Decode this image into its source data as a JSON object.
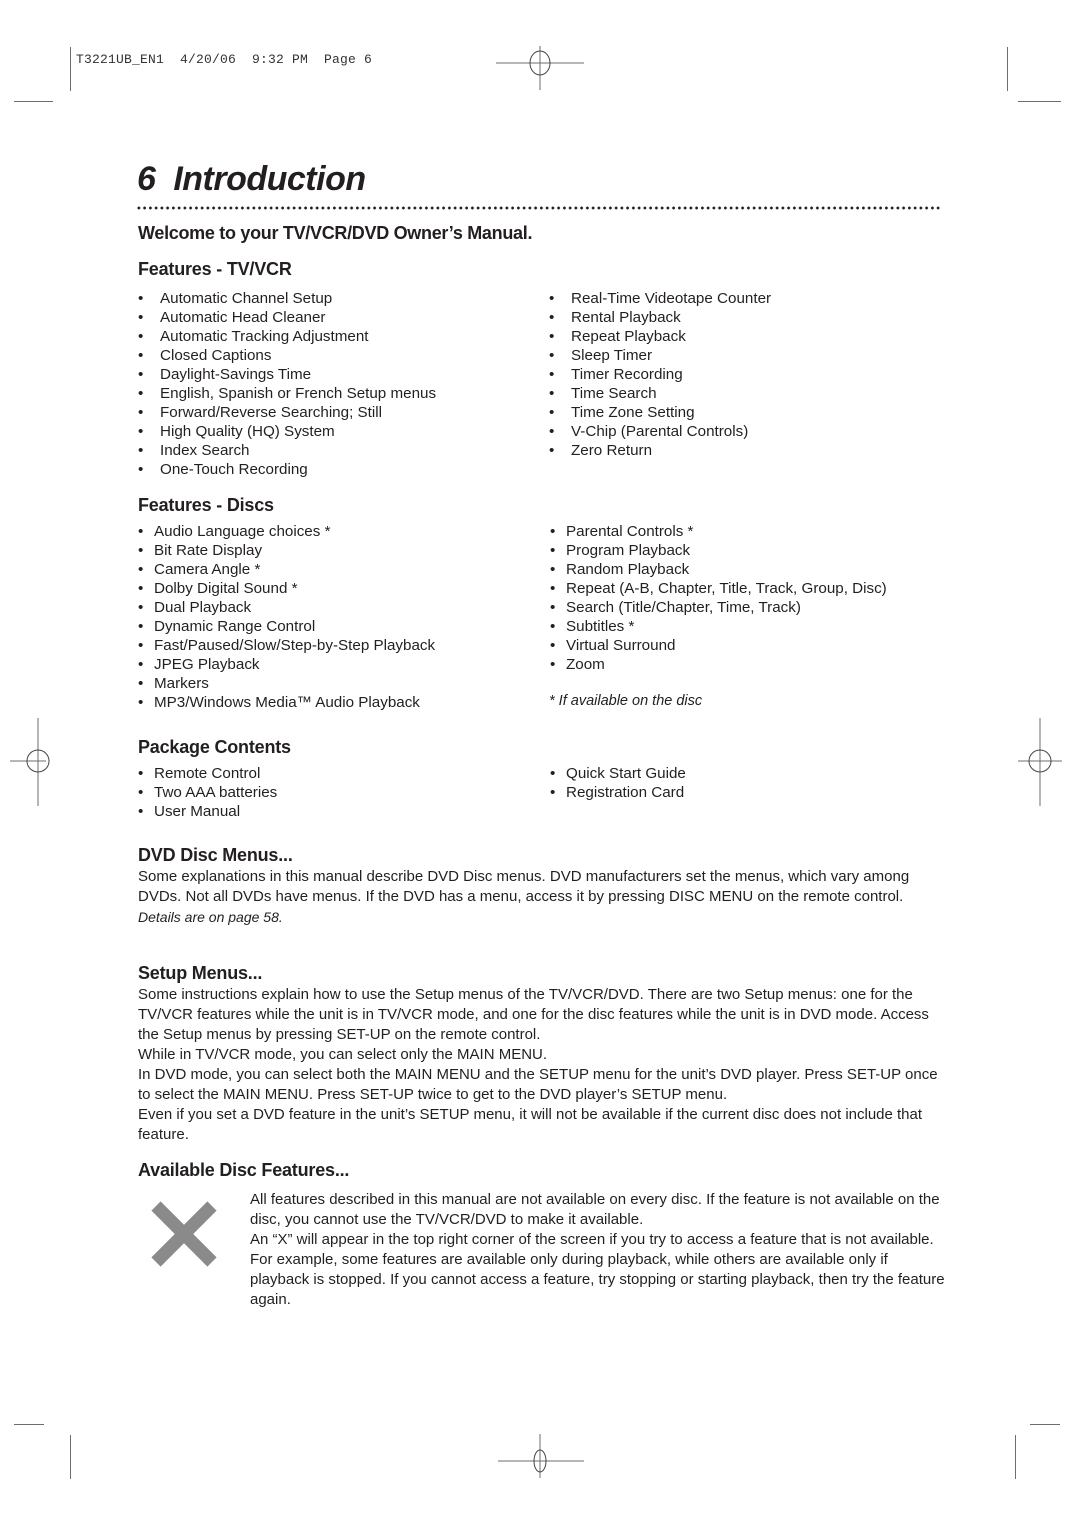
{
  "print_slug": "T3221UB_EN1  4/20/06  9:32 PM  Page 6",
  "page": {
    "number": "6",
    "title": "Introduction"
  },
  "welcome": "Welcome to your TV/VCR/DVD Owner’s Manual.",
  "features_tvvcr": {
    "heading": "Features - TV/VCR",
    "left": [
      "Automatic Channel Setup",
      "Automatic Head Cleaner",
      "Automatic Tracking Adjustment",
      "Closed Captions",
      "Daylight-Savings Time",
      "English, Spanish or French Setup menus",
      "Forward/Reverse Searching; Still",
      "High Quality (HQ) System",
      "Index Search",
      "One-Touch Recording"
    ],
    "right": [
      "Real-Time Videotape Counter",
      "Rental Playback",
      "Repeat Playback",
      "Sleep Timer",
      "Timer Recording",
      "Time Search",
      "Time Zone Setting",
      "V-Chip (Parental Controls)",
      "Zero Return"
    ]
  },
  "features_discs": {
    "heading": "Features - Discs",
    "left": [
      "Audio Language choices *",
      "Bit Rate Display",
      "Camera Angle *",
      "Dolby Digital Sound *",
      "Dual Playback",
      "Dynamic Range Control",
      "Fast/Paused/Slow/Step-by-Step Playback",
      "JPEG Playback",
      "Markers",
      "MP3/Windows Media™ Audio Playback"
    ],
    "right": [
      "Parental Controls *",
      "Program Playback",
      "Random Playback",
      "Repeat (A-B, Chapter, Title, Track, Group, Disc)",
      "Search (Title/Chapter, Time, Track)",
      "Subtitles *",
      "Virtual Surround",
      "Zoom"
    ],
    "footnote": "* If available on the disc"
  },
  "package_contents": {
    "heading": "Package Contents",
    "left": [
      "Remote Control",
      "Two AAA batteries",
      "User Manual"
    ],
    "right": [
      "Quick Start Guide",
      "Registration Card"
    ]
  },
  "dvd_disc_menus": {
    "heading": "DVD Disc Menus...",
    "body": "Some explanations in this manual describe DVD Disc menus. DVD manufacturers set the menus, which vary among DVDs. Not all DVDs have menus. If the DVD has a menu, access it by pressing DISC MENU on the remote control.",
    "details": "Details are on page 58."
  },
  "setup_menus": {
    "heading": "Setup Menus...",
    "paragraphs": [
      "Some instructions explain how to use the Setup menus of the TV/VCR/DVD. There are two Setup menus: one for the TV/VCR features while the unit is in TV/VCR mode, and one for the disc features while the unit is in DVD mode. Access the Setup menus by pressing SET-UP on the remote control.",
      "While in TV/VCR mode, you can select only the MAIN MENU.",
      "In DVD mode, you can select both the MAIN MENU and the SETUP menu for the unit’s DVD player. Press SET-UP once to select the MAIN MENU. Press SET-UP twice to get to the DVD player’s SETUP menu.",
      "Even if you set a DVD feature in the unit’s SETUP menu, it will not be available if the current disc does not include that feature."
    ]
  },
  "available_disc_features": {
    "heading": "Available Disc Features...",
    "icon": "x-icon",
    "icon_color": "#8a8a8a",
    "paragraphs": [
      "All features described in this manual are not available on every disc. If the feature is not available on the disc, you cannot use the TV/VCR/DVD to make it available.",
      "An “X” will appear in the top right corner of the screen if you try to access a feature that is not available.",
      "For example, some features are available only during playback, while others are available only if playback is stopped. If you cannot access a feature, try stopping or starting playback, then try the feature again."
    ]
  }
}
